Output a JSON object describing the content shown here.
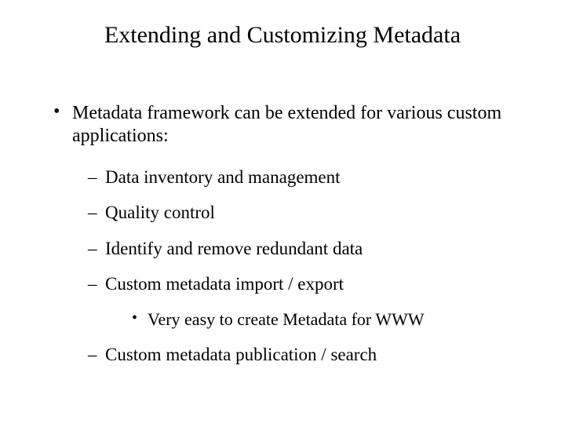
{
  "title": "Extending and Customizing Metadata",
  "bullets": {
    "b1": "Metadata framework can be extended for various custom applications:",
    "b2a": "Data inventory and management",
    "b2b": "Quality control",
    "b2c": "Identify and remove redundant data",
    "b2d": "Custom metadata import / export",
    "b3a": "Very easy to create Metadata for WWW",
    "b2e": "Custom metadata publication / search"
  }
}
